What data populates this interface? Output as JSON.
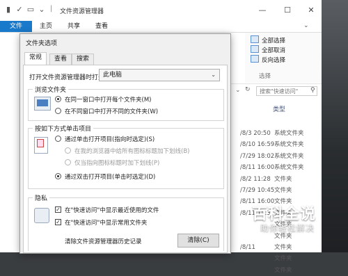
{
  "window": {
    "title": "文件资源管理器",
    "minimize": "—",
    "maximize": "☐",
    "close": "✕"
  },
  "ribbon": {
    "tabs": [
      "文件",
      "主页",
      "共享",
      "查看"
    ],
    "select_items": [
      "全部选择",
      "全部取消",
      "反向选择"
    ],
    "select_group": "选择"
  },
  "nav": {
    "search_placeholder": "搜索\"快速访问\""
  },
  "file_list": {
    "type_header": "类型",
    "rows": [
      {
        "date": "/8/3 20:50",
        "type": "系统文件夹"
      },
      {
        "date": "/8/10 16:59",
        "type": "系统文件夹"
      },
      {
        "date": "/7/29 18:02",
        "type": "系统文件夹"
      },
      {
        "date": "/8/11 16:00",
        "type": "系统文件夹"
      },
      {
        "date": "/8/2 11:28",
        "type": "文件夹"
      },
      {
        "date": "/7/29 10:45",
        "type": "文件夹"
      },
      {
        "date": "/8/11 16:00",
        "type": "文件夹"
      },
      {
        "date": "/8/11 15:34",
        "type": "文件夹"
      },
      {
        "date": "",
        "type": "文件夹"
      },
      {
        "date": "",
        "type": "文件夹"
      },
      {
        "date": "/8/11",
        "type": "文件夹"
      },
      {
        "date": "",
        "type": "文件夹"
      },
      {
        "date": "",
        "type": "文件夹"
      }
    ]
  },
  "dialog": {
    "title": "文件夹选项",
    "tabs": [
      "常规",
      "查看",
      "搜索"
    ],
    "open_label": "打开文件资源管理器时打开:",
    "open_value": "此电脑",
    "browse_group": "浏览文件夹",
    "browse_options": [
      "在同一窗口中打开每个文件夹(M)",
      "在不同窗口中打开不同的文件夹(W)"
    ],
    "click_group": "按如下方式单击项目",
    "click_single": "通过单击打开项目(指向时选定)(S)",
    "click_sub1": "在我的浏览器中给所有图标标题加下划线(B)",
    "click_sub2": "仅当指向图标标题时加下划线(P)",
    "click_double": "通过双击打开项目(单击时选定)(D)",
    "privacy_group": "隐私",
    "privacy_recent": "在\"快速访问\"中显示最近使用的文件",
    "privacy_frequent": "在\"快速访问\"中显示常用文件夹",
    "clear_label": "清除文件资源管理器历史记录",
    "clear_button": "清除(C)"
  },
  "watermark": {
    "logo": "百科全说",
    "sub": "助你轻松解决"
  },
  "colors": {
    "accent": "#1979ca",
    "dialog_bg": "#f0f0f0"
  }
}
